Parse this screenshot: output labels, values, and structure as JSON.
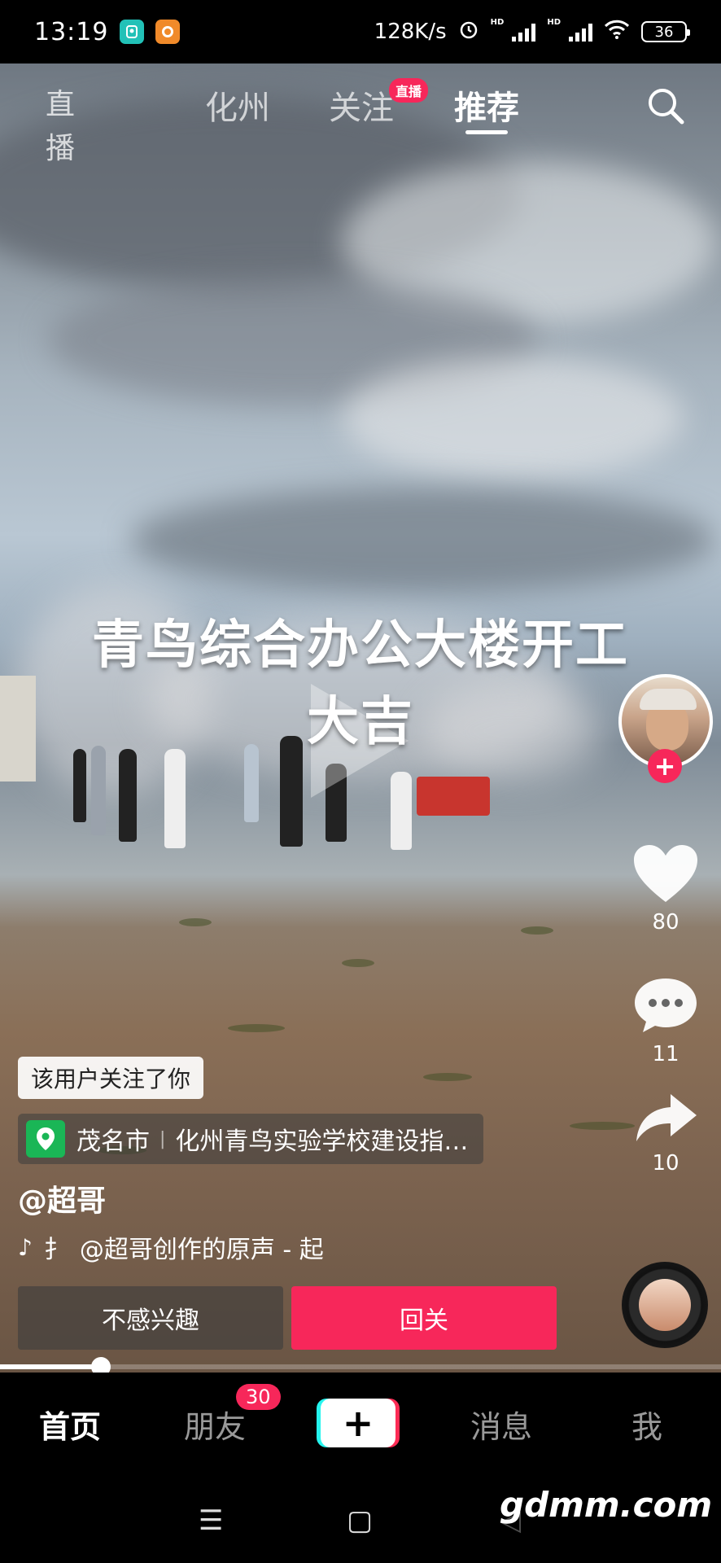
{
  "status_bar": {
    "time": "13:19",
    "network_speed": "128K/s",
    "battery": "36",
    "hd_label": "HD"
  },
  "top_nav": {
    "live_label": "直播",
    "tabs": [
      {
        "label": "化州"
      },
      {
        "label": "关注"
      },
      {
        "label": "推荐"
      }
    ],
    "live_badge": "直播"
  },
  "video": {
    "caption_line1": "青鸟综合办公大楼开工",
    "caption_line2": "大吉"
  },
  "right_rail": {
    "follow_symbol": "+",
    "likes": "80",
    "comments": "11",
    "shares": "10"
  },
  "info": {
    "followed_tag": "该用户关注了你",
    "location_city": "茂名市",
    "location_sep": "|",
    "location_place": "化州青鸟实验学校建设指…",
    "username": "@超哥",
    "music_prefix": "扌",
    "music_text": "@超哥创作的原声 - 起",
    "btn_uninterested": "不感兴趣",
    "btn_followback": "回关"
  },
  "progress": {
    "value": 0.14
  },
  "bottom_nav": {
    "home": "首页",
    "friends": "朋友",
    "friends_badge": "30",
    "create": "+",
    "messages": "消息",
    "me": "我"
  },
  "system_nav": {
    "menu": "☰",
    "home": "▢",
    "back": "◁"
  },
  "watermark": "gdmm.com",
  "colors": {
    "accent": "#f7275a",
    "location_pin": "#1ab656"
  }
}
